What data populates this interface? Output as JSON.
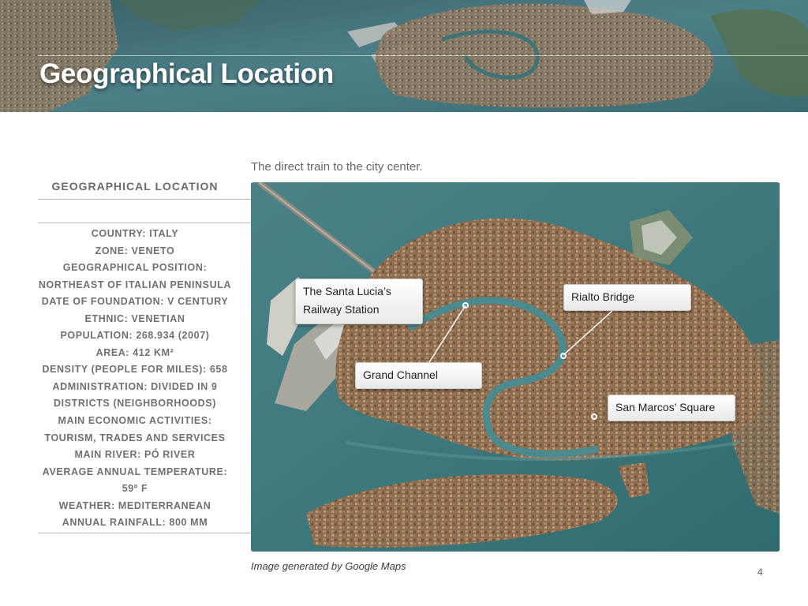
{
  "slide": {
    "title": "Geographical Location",
    "page_number": "4"
  },
  "info": {
    "heading": "GEOGRAPHICAL LOCATION",
    "lines": [
      "COUNTRY: ITALY",
      "ZONE: VENETO",
      "GEOGRAPHICAL POSITION:",
      "NORTHEAST OF ITALIAN PENINSULA",
      "DATE OF FOUNDATION: V CENTURY",
      "ETHNIC: VENETIAN",
      "POPULATION: 268.934 (2007)",
      "AREA: 412 KM²",
      "DENSITY (PEOPLE FOR MILES): 658",
      "ADMINISTRATION: DIVIDED IN 9",
      "DISTRICTS (NEIGHBORHOODS)",
      "MAIN ECONOMIC ACTIVITIES:",
      "TOURISM, TRADES AND SERVICES",
      "MAIN RIVER: PÓ RIVER",
      "AVERAGE ANNUAL TEMPERATURE:",
      "59º F",
      "WEATHER: MEDITERRANEAN",
      "ANNUAL RAINFALL: 800 MM"
    ]
  },
  "map": {
    "caption": "The direct train to the city center.",
    "credit": "Image generated by Google Maps",
    "labels": {
      "station_line1": "The Santa Lucia’s",
      "station_line2": "Railway Station",
      "rialto": "Rialto Bridge",
      "grand_channel": "Grand Channel",
      "san_marcos": "San Marcos’ Square"
    }
  },
  "colors": {
    "water": "#3f7c80",
    "land": "#8a6e52",
    "heading_text": "#6b6b6b"
  }
}
